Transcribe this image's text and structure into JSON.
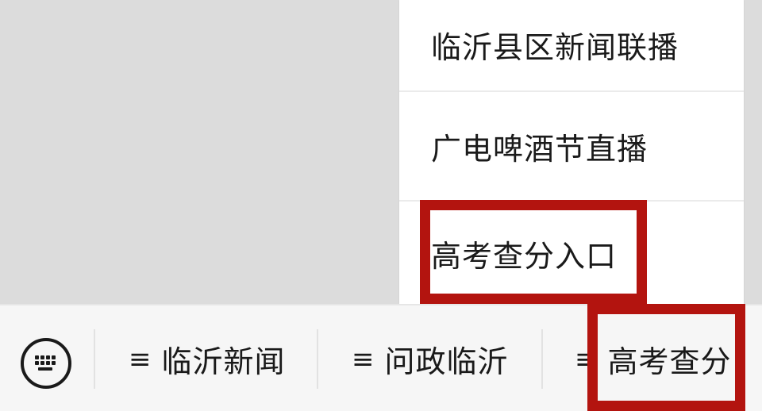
{
  "submenu": {
    "items": [
      {
        "label": "临沂县区新闻联播"
      },
      {
        "label": "广电啤酒节直播"
      },
      {
        "label": "高考查分入口"
      }
    ]
  },
  "bottom_menu": {
    "keyboard_icon": "keyboard-icon",
    "tab_icon": "≡",
    "tabs": [
      {
        "label": "临沂新闻"
      },
      {
        "label": "问政临沂"
      },
      {
        "label": "高考查分"
      }
    ]
  },
  "colors": {
    "highlight": "#b3140f",
    "background": "#dcdcdc",
    "menu_bg": "#ffffff",
    "bar_bg": "#f6f6f6"
  }
}
